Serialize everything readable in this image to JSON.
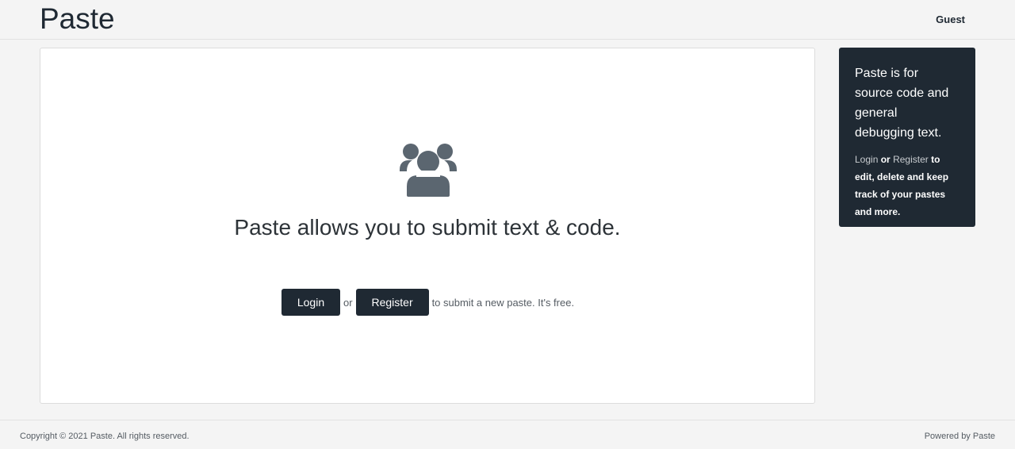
{
  "header": {
    "brand": "Paste",
    "user_label": "Guest"
  },
  "main": {
    "icon": "users-icon",
    "headline": "Paste allows you to submit text & code.",
    "login_label": "Login",
    "or_text": "or",
    "register_label": "Register",
    "tail_text": "to submit a new paste. It's free."
  },
  "sidebar": {
    "heading": "Paste is for source code and general debugging text.",
    "login_link": "Login",
    "or_text": "or",
    "register_link": "Register",
    "body_text": "to edit, delete and keep track of your pastes and more."
  },
  "footer": {
    "copyright": "Copyright © 2021 Paste. All rights reserved.",
    "powered_by": "Powered by Paste"
  },
  "colors": {
    "page_bg": "#f4f4f4",
    "dark": "#1f2933",
    "icon": "#5b6670",
    "card_bg": "#ffffff"
  }
}
